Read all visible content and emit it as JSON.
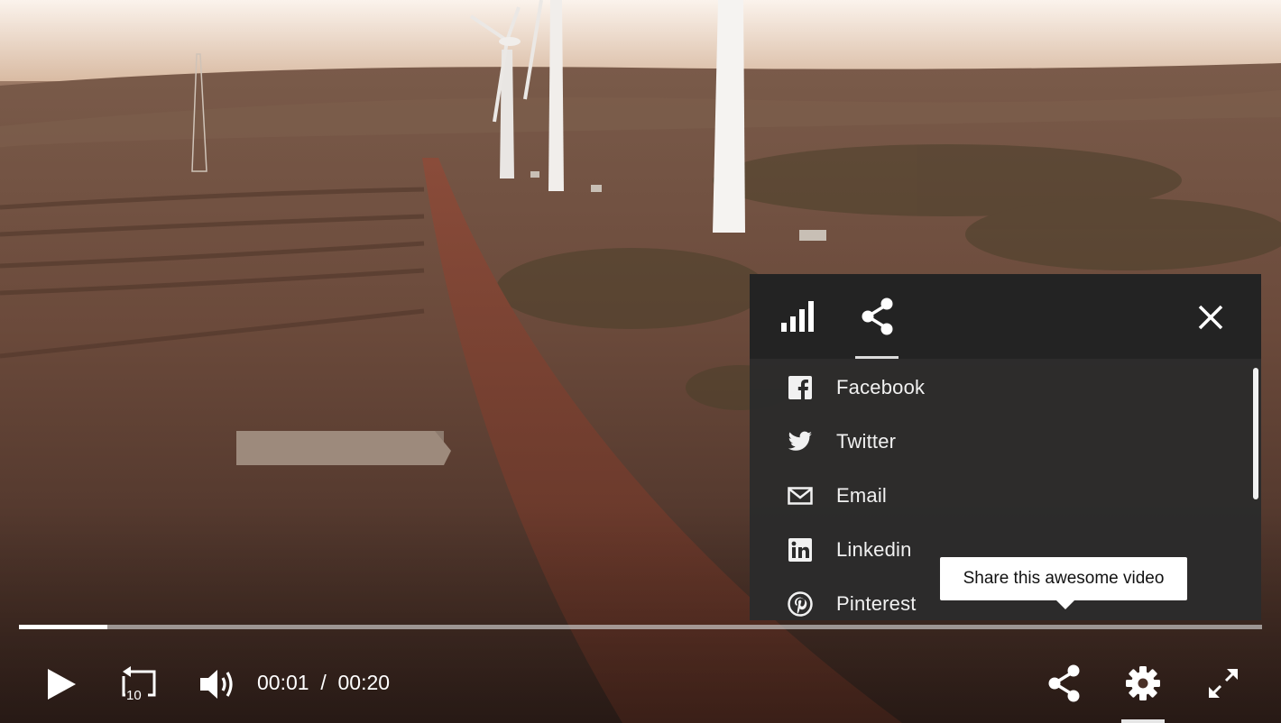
{
  "player": {
    "current_time": "00:01",
    "separator": "/",
    "duration": "00:20",
    "progress_fraction": 0.071
  },
  "panel": {
    "tabs": [
      {
        "icon": "stats-bars-icon",
        "active": false
      },
      {
        "icon": "share-icon",
        "active": true
      }
    ],
    "share_options": [
      {
        "label": "Facebook",
        "icon": "facebook-icon"
      },
      {
        "label": "Twitter",
        "icon": "twitter-icon"
      },
      {
        "label": "Email",
        "icon": "email-icon"
      },
      {
        "label": "Linkedin",
        "icon": "linkedin-icon"
      },
      {
        "label": "Pinterest",
        "icon": "pinterest-icon"
      }
    ]
  },
  "tooltip": {
    "text": "Share this awesome video"
  },
  "controls": {
    "play_icon": "play-icon",
    "rewind_icon": "rewind-10-icon",
    "rewind_seconds": "10",
    "volume_icon": "volume-icon",
    "share_icon": "share-icon",
    "settings_icon": "gear-icon",
    "fullscreen_icon": "fullscreen-icon"
  }
}
